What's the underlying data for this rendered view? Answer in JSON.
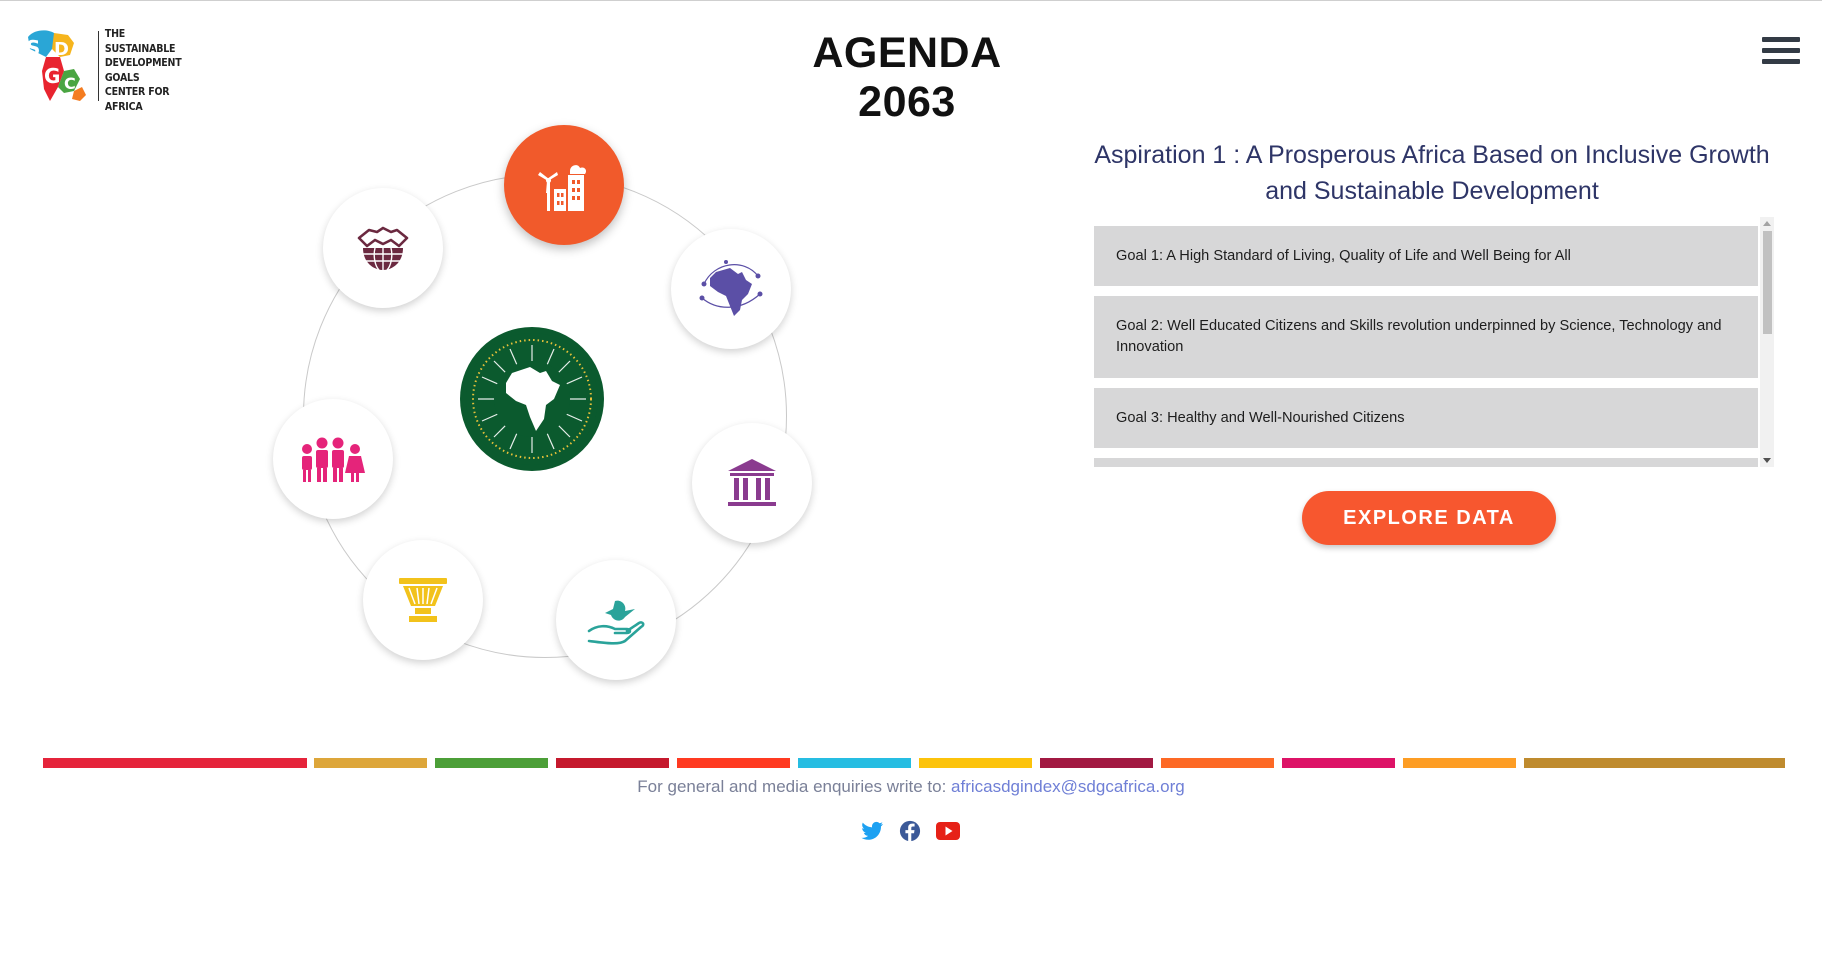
{
  "header": {
    "logo_text": "THE SUSTAINABLE\nDEVELOPMENT\nGOALS\nCENTER FOR\nAFRICA",
    "logo_letters": [
      "S",
      "D",
      "G",
      "C"
    ],
    "title": "AGENDA 2063",
    "menu_icon": "hamburger-icon"
  },
  "wheel": {
    "center_emblem": "african-union-emblem",
    "aspirations": [
      {
        "icon": "wind-turbine-city-icon",
        "color": "#f15a2b",
        "active": true
      },
      {
        "icon": "africa-network-map-icon",
        "color": "#5b4fa6",
        "active": false
      },
      {
        "icon": "institution-columns-icon",
        "color": "#8a3b8f",
        "active": false
      },
      {
        "icon": "dove-hand-icon",
        "color": "#2aa39a",
        "active": false
      },
      {
        "icon": "drum-icon",
        "color": "#f2c21b",
        "active": false
      },
      {
        "icon": "family-people-icon",
        "color": "#e5247a",
        "active": false
      },
      {
        "icon": "handshake-globe-icon",
        "color": "#6b2940",
        "active": false
      }
    ]
  },
  "panel": {
    "aspiration_title": "Aspiration 1 : A Prosperous Africa Based on Inclusive Growth and Sustainable Development",
    "goals": [
      "Goal 1: A High Standard of Living, Quality of Life and Well Being for All",
      "Goal 2: Well Educated Citizens and Skills revolution underpinned by Science, Technology and Innovation",
      "Goal 3: Healthy and Well-Nourished Citizens"
    ],
    "explore_label": "EXPLORE DATA"
  },
  "footer": {
    "color_segments": [
      "#e5243b",
      "#dda63a",
      "#4c9f38",
      "#c5192d",
      "#ff3a21",
      "#26bde2",
      "#fcc30b",
      "#a21942",
      "#fd6925",
      "#dd1367",
      "#fd9d24",
      "#bf8b2e"
    ],
    "enquiry_text": "For general and media enquiries write to: ",
    "email": "africasdgindex@sdgcafrica.org",
    "socials": [
      {
        "icon": "twitter-icon",
        "color": "#1da1f2"
      },
      {
        "icon": "facebook-icon",
        "color": "#3b5998"
      },
      {
        "icon": "youtube-icon",
        "color": "#e62117"
      }
    ]
  }
}
